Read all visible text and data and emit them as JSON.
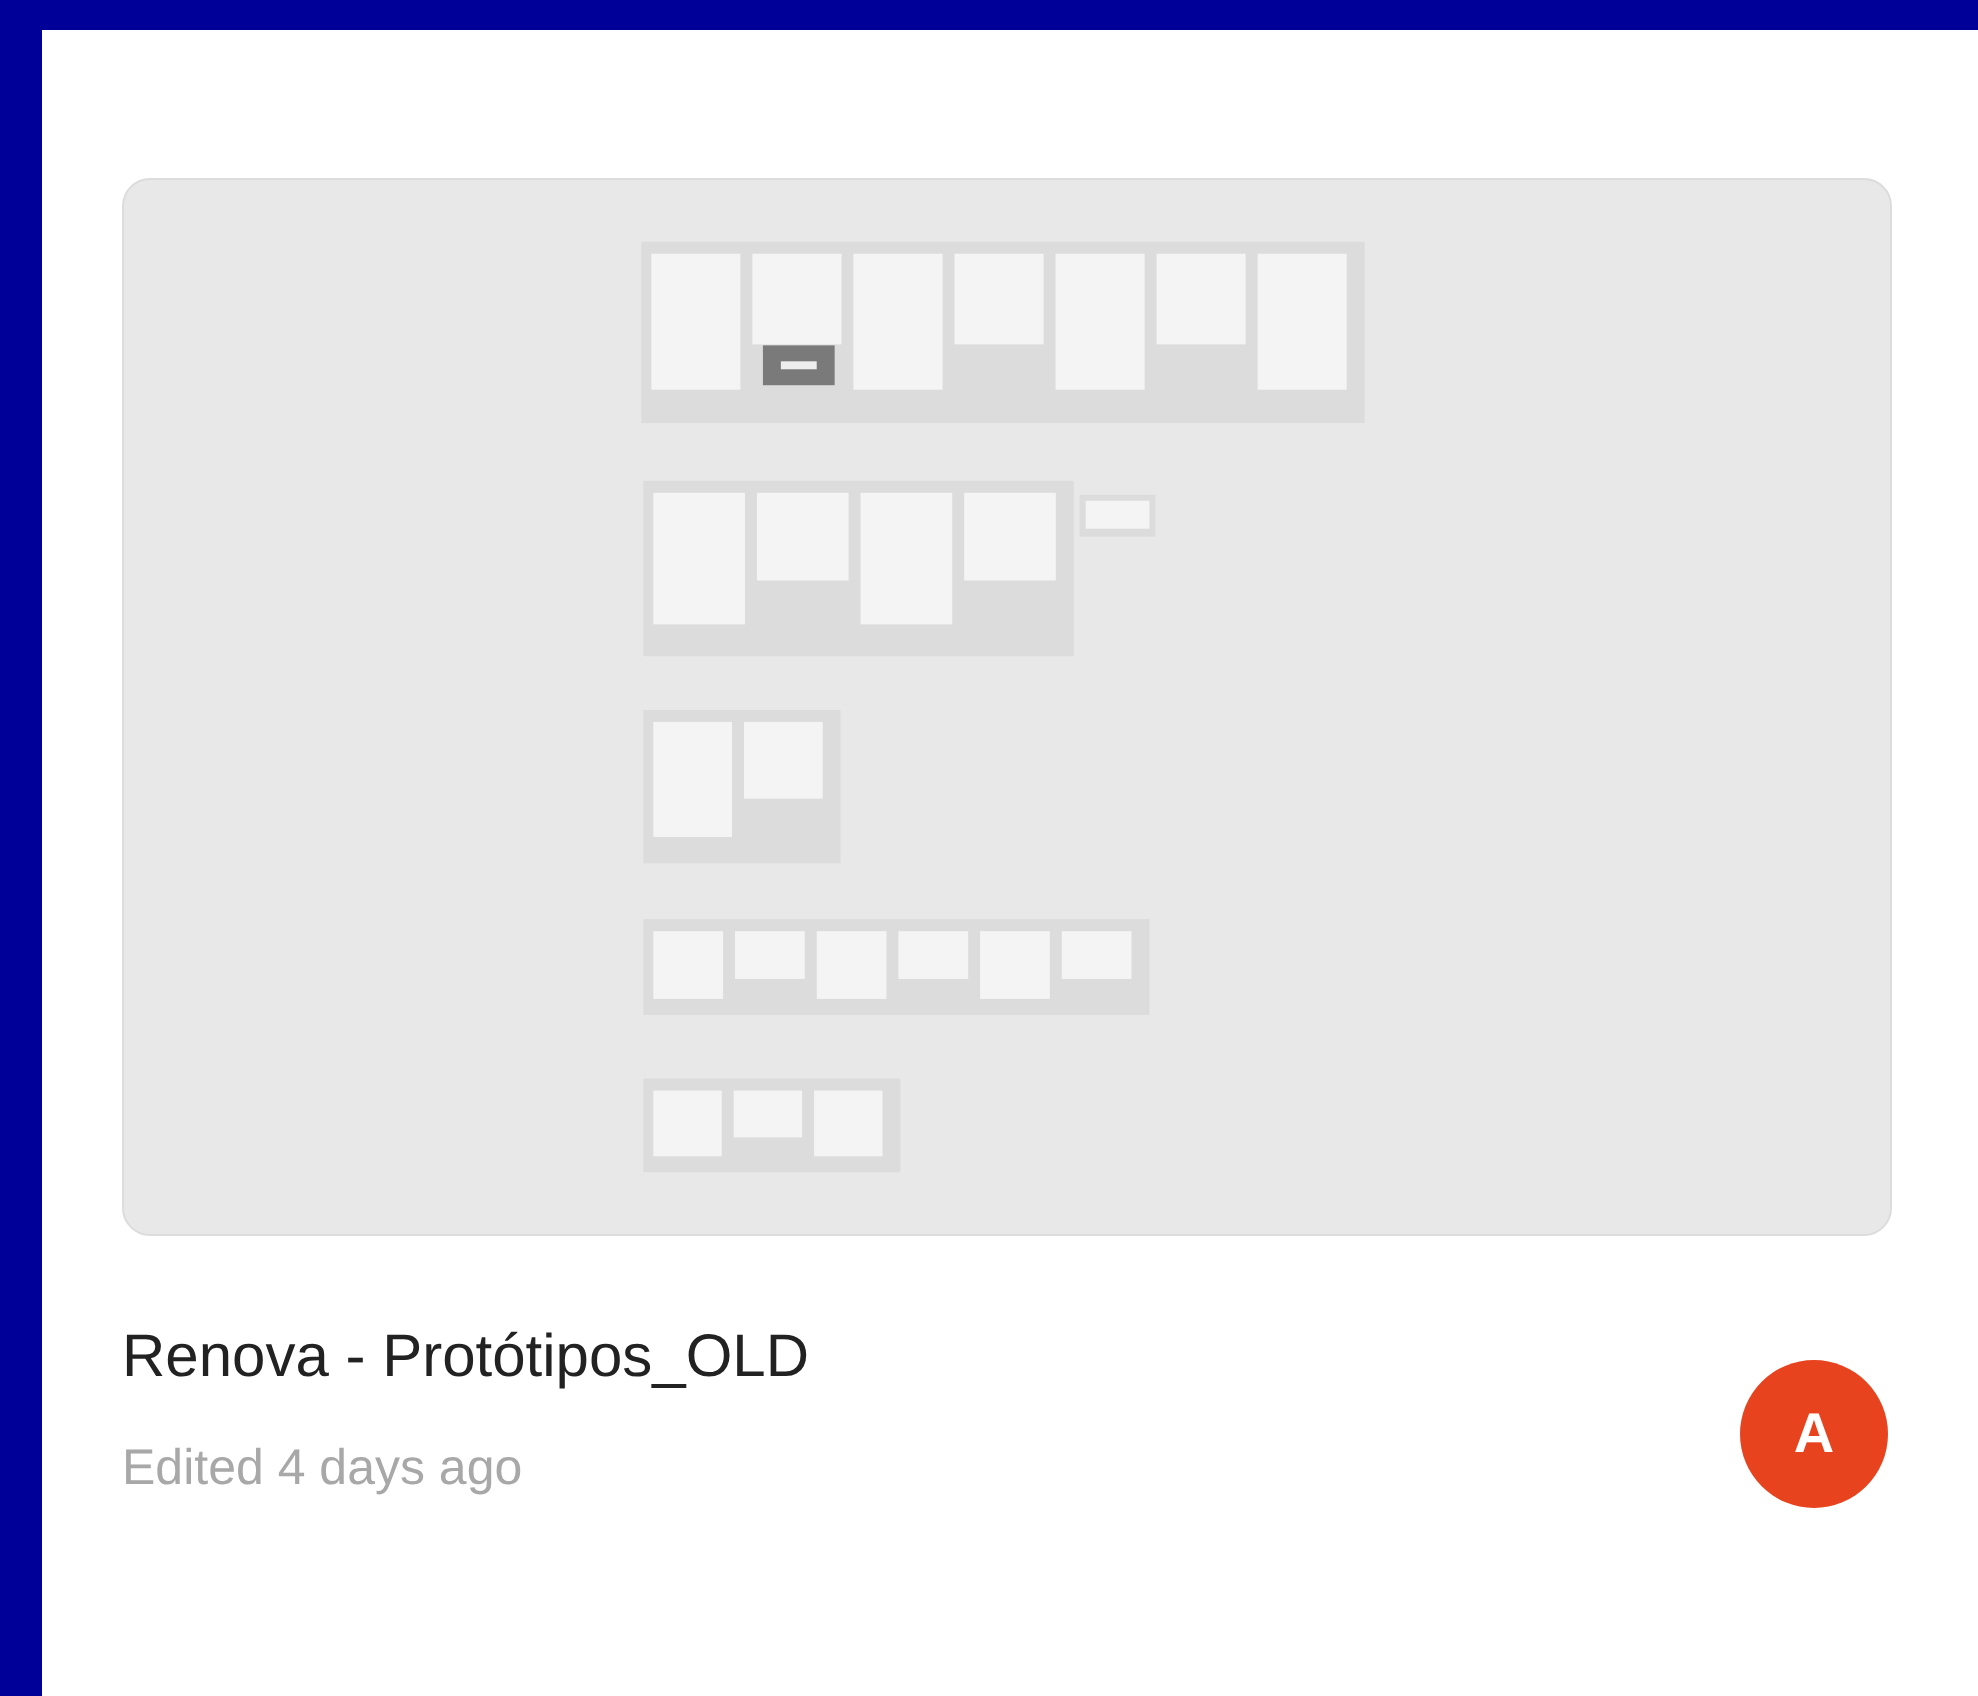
{
  "file": {
    "title": "Renova - Protótipos_OLD",
    "edited": "Edited 4 days ago",
    "owner_initial": "A"
  }
}
